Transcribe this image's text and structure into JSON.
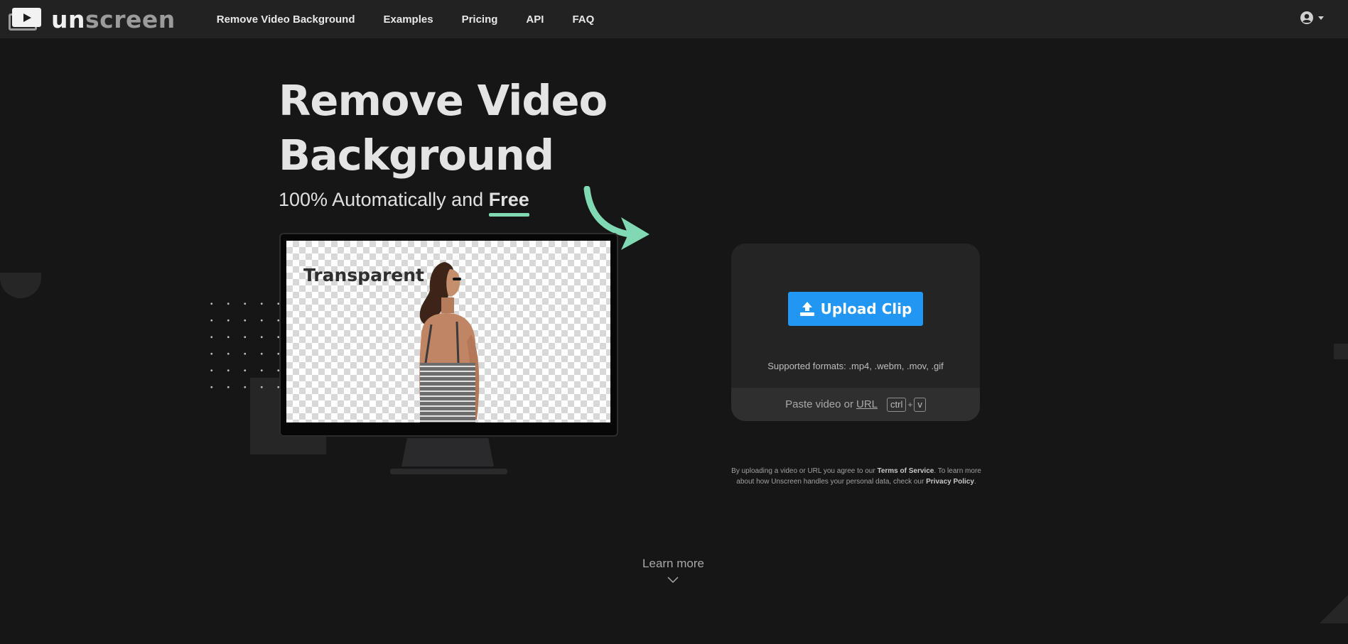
{
  "brand": {
    "logo_text_bold": "un",
    "logo_text_light": "screen"
  },
  "nav": {
    "links": [
      "Remove Video Background",
      "Examples",
      "Pricing",
      "API",
      "FAQ"
    ],
    "user_icon": "user-circle-icon"
  },
  "hero": {
    "title_line1": "Remove Video",
    "title_line2": "Background",
    "subtitle_prefix": "100% Automatically and ",
    "subtitle_highlight": "Free"
  },
  "preview": {
    "label": "Transparent"
  },
  "upload": {
    "button_label": "Upload Clip",
    "formats_text": "Supported formats: .mp4, .webm, .mov, .gif",
    "paste_prefix": "Paste video or",
    "paste_link": "URL",
    "key_ctrl": "ctrl",
    "key_plus": "+",
    "key_v": "v"
  },
  "legal": {
    "part1": "By uploading a video or URL you agree to our ",
    "terms_link": "Terms of Service",
    "part2": ". To learn more about how Unscreen handles your personal data, check our ",
    "privacy_link": "Privacy Policy",
    "part3": "."
  },
  "learn_more": {
    "label": "Learn more"
  },
  "colors": {
    "background": "#161617",
    "nav_background": "#222223",
    "accent_blue": "#2196f3",
    "accent_mint": "#80d9b3",
    "card_background": "#242425"
  }
}
